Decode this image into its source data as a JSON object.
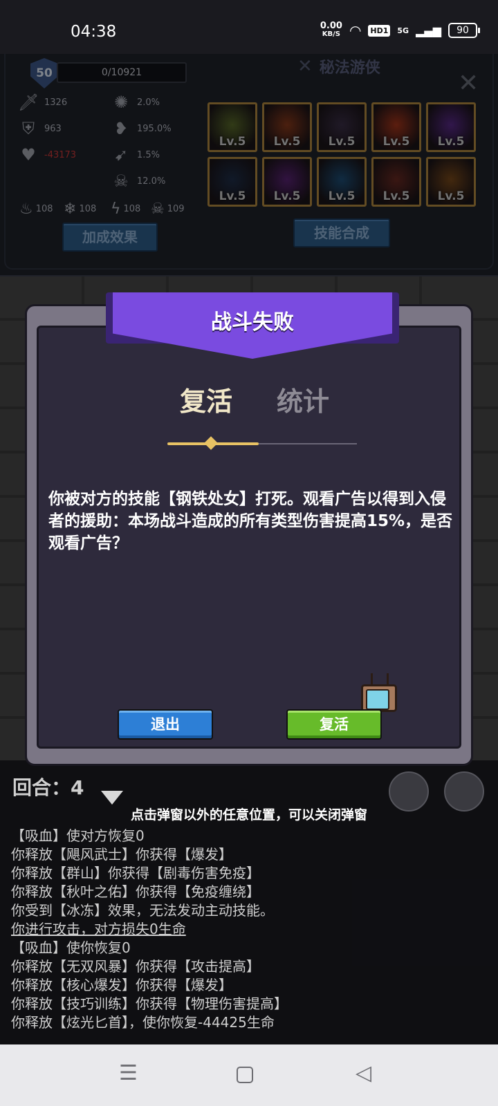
{
  "status_bar": {
    "time": "04:38",
    "net_speed_value": "0.00",
    "net_speed_unit": "KB/S",
    "hd": "HD1",
    "network": "5G",
    "battery": "90"
  },
  "character": {
    "level": "50",
    "xp": "0/10921",
    "class_name": "秘法游侠",
    "stats": [
      {
        "icon": "sword-icon",
        "value": "1326"
      },
      {
        "icon": "shield-icon",
        "value": "963"
      },
      {
        "icon": "heart-icon",
        "value": "-43173"
      },
      {
        "icon": "splash-icon",
        "value": "2.0%"
      },
      {
        "icon": "bleeding-heart-icon",
        "value": "195.0%"
      },
      {
        "icon": "speed-icon",
        "value": "1.5%"
      },
      {
        "icon": "skull-icon",
        "value": "12.0%"
      }
    ],
    "elements": [
      {
        "icon": "fire-icon",
        "value": "108"
      },
      {
        "icon": "frost-icon",
        "value": "108"
      },
      {
        "icon": "lightning-icon",
        "value": "108"
      },
      {
        "icon": "poison-skull-icon",
        "value": "109"
      }
    ],
    "bonus_button": "加成效果",
    "synth_button": "技能合成",
    "skills": [
      {
        "level": "Lv.5",
        "color": "#5a6b2a"
      },
      {
        "level": "Lv.5",
        "color": "#8a3a1c"
      },
      {
        "level": "Lv.5",
        "color": "#3b2f47"
      },
      {
        "level": "Lv.5",
        "color": "#a7361c"
      },
      {
        "level": "Lv.5",
        "color": "#5a2a8a"
      },
      {
        "level": "Lv.5",
        "color": "#1f2f4a"
      },
      {
        "level": "Lv.5",
        "color": "#5a2375"
      },
      {
        "level": "Lv.5",
        "color": "#1e4f78"
      },
      {
        "level": "Lv.5",
        "color": "#6a2a22"
      },
      {
        "level": "Lv.5",
        "color": "#7a4a1c"
      }
    ]
  },
  "dialog": {
    "title": "战斗失败",
    "tab_revive": "复活",
    "tab_stats": "统计",
    "message": "你被对方的技能【钢铁处女】打死。观看广告以得到入侵者的援助：本场战斗造成的所有类型伤害提高15%，是否观看广告？",
    "exit_button": "退出",
    "revive_button": "复活"
  },
  "battle": {
    "round_label": "回合：4",
    "hint": "点击弹窗以外的任意位置，可以关闭弹窗",
    "log": [
      "【吸血】使对方恢复0",
      "你释放【飓风武士】你获得【爆发】",
      "你释放【群山】你获得【剧毒伤害免疫】",
      "你释放【秋叶之佑】你获得【免疫缠绕】",
      "你受到【冰冻】效果，无法发动主动技能。",
      "你进行攻击，对方损失0生命",
      "【吸血】使你恢复0",
      "你释放【无双风暴】你获得【攻击提高】",
      "你释放【核心爆发】你获得【爆发】",
      "你释放【技巧训练】你获得【物理伤害提高】",
      "你释放【炫光匕首】，使你恢复-44425生命"
    ]
  }
}
